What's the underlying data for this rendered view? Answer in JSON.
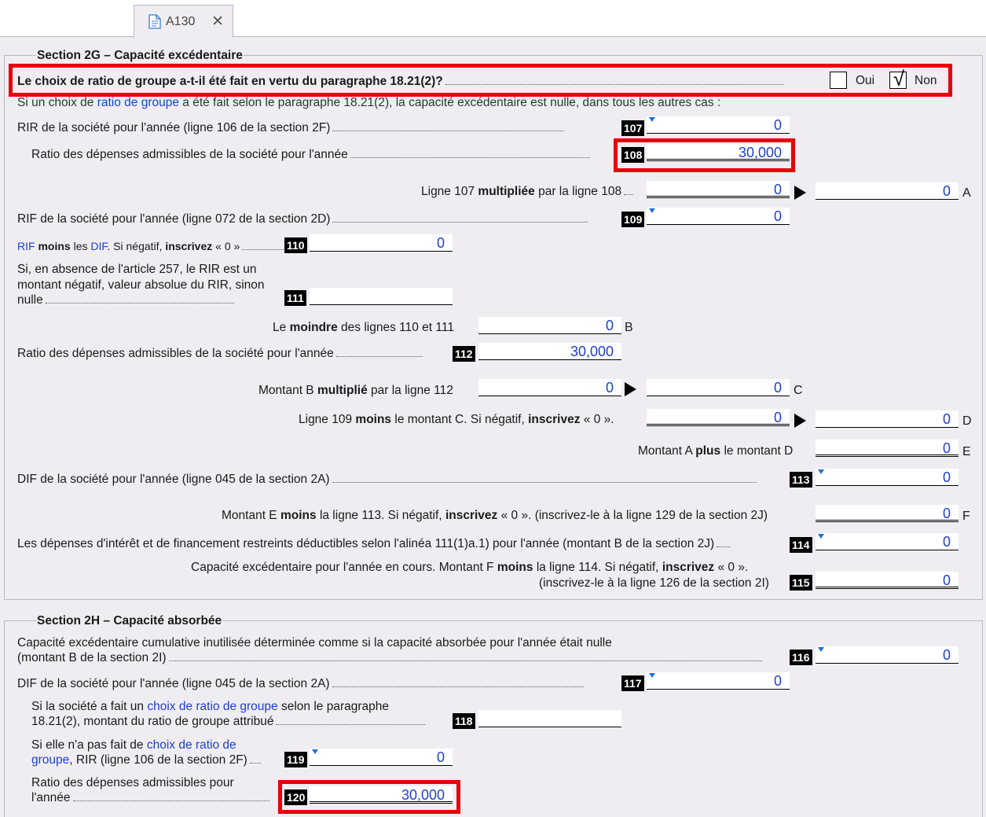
{
  "tab": {
    "label": "A130",
    "icon": "document-icon",
    "close_icon": "close-icon"
  },
  "section2g": {
    "legend": "Section 2G – Capacité excédentaire",
    "question": "Le choix de ratio de groupe a-t-il été fait en vertu du paragraphe 18.21(2)?",
    "oui": "Oui",
    "non": "Non",
    "non_checked": true,
    "intro_a": "Si un choix de",
    "intro_link": "ratio de groupe",
    "intro_b": "a été fait selon le paragraphe 18.21(2), la capacité excédentaire est nulle, dans tous les autres cas :",
    "l107": {
      "text": "RIR de la société pour l'année (ligne 106 de la section 2F)",
      "code": "107",
      "value": "0"
    },
    "l108": {
      "text": "Ratio des dépenses admissibles de la société pour l'année",
      "code": "108",
      "value": "30,000"
    },
    "lA": {
      "pre": "Ligne 107",
      "bold": "multipliée",
      "post": "par la ligne 108",
      "value1": "0",
      "value2": "0",
      "letter": "A"
    },
    "l109": {
      "text": "RIF de la société pour l'année (ligne 072 de la section 2D)",
      "code": "109",
      "value": "0"
    },
    "l110": {
      "p1": "RIF",
      "p2": "moins",
      "p3": "les",
      "p4": "DIF",
      "p5": ". Si négatif,",
      "p6": "inscrivez",
      "p7": "« 0 »",
      "code": "110",
      "value": "0"
    },
    "l111": {
      "text": "Si, en absence de l'article 257, le RIR est un montant négatif, valeur absolue du RIR, sinon nulle",
      "code": "111",
      "value": ""
    },
    "lB": {
      "pre": "Le",
      "bold": "moindre",
      "post": "des lignes 110 et 111",
      "value": "0",
      "letter": "B"
    },
    "l112": {
      "text": "Ratio des dépenses admissibles de la société pour l'année",
      "code": "112",
      "value": "30,000"
    },
    "lC": {
      "pre": "Montant B",
      "bold": "multiplié",
      "post": "par la ligne 112",
      "value1": "0",
      "value2": "0",
      "letter": "C"
    },
    "lD": {
      "pre": "Ligne 109",
      "bold": "moins",
      "mid": "le montant C. Si négatif,",
      "bold2": "inscrivez",
      "post": "« 0 ».",
      "value1": "0",
      "value2": "0",
      "letter": "D"
    },
    "lE": {
      "pre": "Montant A",
      "bold": "plus",
      "post": "le montant D",
      "value": "0",
      "letter": "E"
    },
    "l113": {
      "text": "DIF de la société pour l'année (ligne 045 de la section 2A)",
      "code": "113",
      "value": "0"
    },
    "lF": {
      "pre": "Montant E",
      "bold": "moins",
      "mid": "la ligne 113. Si négatif,",
      "bold2": "inscrivez",
      "post": "« 0 ». (inscrivez-le à la ligne 129 de la section 2J)",
      "value": "0",
      "letter": "F"
    },
    "l114": {
      "text": "Les dépenses d'intérêt et de financement restreints déductibles selon l'alinéa 111(1)a.1) pour l'année (montant B de la section 2J)",
      "code": "114",
      "value": "0"
    },
    "l115": {
      "pre": "Capacité excédentaire pour l'année en cours. Montant F",
      "bold": "moins",
      "mid": "la ligne 114. Si négatif,",
      "bold2": "inscrivez",
      "post": "« 0 ».",
      "line2": "(inscrivez-le à la ligne 126 de la section 2I)",
      "code": "115",
      "value": "0"
    }
  },
  "section2h": {
    "legend": "Section 2H – Capacité absorbée",
    "l116": {
      "line1": "Capacité excédentaire cumulative inutilisée déterminée comme si la capacité absorbée pour l'année était nulle",
      "line2": "(montant B de la section 2I)",
      "code": "116",
      "value": "0"
    },
    "l117": {
      "text": "DIF de la société pour l'année (ligne 045 de la section 2A)",
      "code": "117",
      "value": "0"
    },
    "l118": {
      "p1": "Si la société a fait un",
      "link": "choix de ratio de groupe",
      "p2": "selon le paragraphe",
      "line2": "18.21(2), montant du ratio de groupe attribué",
      "code": "118",
      "value": ""
    },
    "l119": {
      "p1": "Si elle n'a pas fait de",
      "link1": "choix de ratio de",
      "link2": "groupe",
      "p2": ", RIR (ligne 106 de la section 2F)",
      "code": "119",
      "value": "0"
    },
    "l120": {
      "line1": "Ratio des dépenses admissibles pour",
      "line2": "l'année",
      "code": "120",
      "value": "30,000"
    }
  },
  "colors": {
    "accent_red": "#e8000a",
    "value_blue": "#1f3fd0",
    "background": "#efedf2"
  }
}
